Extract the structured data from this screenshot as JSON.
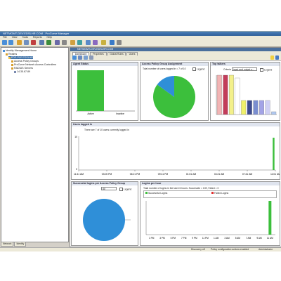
{
  "window": {
    "title": "NETMGMT-DEV.EDSLHR.COM - ProCurve Manager"
  },
  "menu": [
    "File",
    "View",
    "Tools",
    "Reports",
    "Help"
  ],
  "tree": {
    "root": "Identity Management Home",
    "realms": "Realms",
    "realm_selected": "EDS-PLE.EDSLHR",
    "items": [
      "Access Policy Groups",
      "ProCurve Network Access Controllers",
      "RADIUS Servers"
    ],
    "server": "14.35.67.89"
  },
  "left_tabs": [
    "Network",
    "Identity"
  ],
  "host_header": "NETMGMT-DEV.EDSLHR.COM",
  "tabs": [
    "Dashboard",
    "Properties",
    "Global Rules",
    "Users"
  ],
  "panels": {
    "agent_status": {
      "title": "Agent Status",
      "chart_data": {
        "type": "bar",
        "categories": [
          "Active",
          "Inactive"
        ],
        "values": [
          1,
          0
        ]
      }
    },
    "access_policy": {
      "title": "Access Policy Group Assignment",
      "subtitle": "Total number of users logged in = 7 of 10",
      "legend_label": "Legend",
      "chart_data": {
        "type": "pie",
        "values": [
          85,
          15
        ],
        "colors": [
          "#3cbf3c",
          "#2f8fd8"
        ]
      }
    },
    "top_talkers": {
      "title": "Top talkers",
      "criteria_label": "Criteria",
      "criteria_value": "input and output o...",
      "legend_label": "Legend",
      "chart_data": {
        "type": "bar",
        "values": [
          14,
          14,
          14,
          13,
          5,
          5,
          5,
          5,
          5,
          1
        ],
        "colors": [
          "#f2b4b4",
          "#c33c5a",
          "#f3f08a",
          "#ffffff",
          "#f0f06a",
          "#3d4b8f",
          "#7a8ed0",
          "#a3a3e6",
          "#d0d0f4",
          "#b0c8f0"
        ]
      }
    },
    "users_logged": {
      "title": "Users logged in",
      "subtitle": "There are 7 of 10 users currently logged in",
      "chart_data": {
        "type": "line",
        "x": [
          "11:41 AM",
          "03:00 PM",
          "06:21 PM",
          "09:41 PM",
          "01:01 AM",
          "04:21 AM",
          "07:41 AM",
          "11:01 AM"
        ],
        "y_ticks": [
          "10",
          "0"
        ],
        "spike_at": 0.99
      }
    },
    "successful_logins": {
      "title": "Successful logins per Access Policy Group",
      "dropdown": "All",
      "legend_label": "Legend",
      "chart_data": {
        "type": "pie",
        "values": [
          100
        ],
        "colors": [
          "#2f8fd8"
        ]
      }
    },
    "logins_hour": {
      "title": "Logins per hour",
      "subtitle": "Total number of logins in the last 24 hours: Successful = 139, Failed = 0",
      "legend": [
        "Successful Logins",
        "Failed Logins"
      ],
      "legend_colors": [
        "#3cbf3c",
        "#e03030"
      ],
      "chart_data": {
        "type": "bar",
        "categories": [
          "1 PM",
          "3 PM",
          "5 PM",
          "7 PM",
          "9 PM",
          "11 PM",
          "1 AM",
          "3 AM",
          "5 AM",
          "7 AM",
          "9 AM",
          "11 AM"
        ],
        "values": [
          0,
          0,
          0,
          0,
          0,
          0,
          0,
          0,
          0,
          0,
          0,
          139
        ]
      }
    }
  },
  "status": {
    "discovery": "Discovery off",
    "policy": "Policy configuration actions enabled",
    "user": "Administrator"
  }
}
